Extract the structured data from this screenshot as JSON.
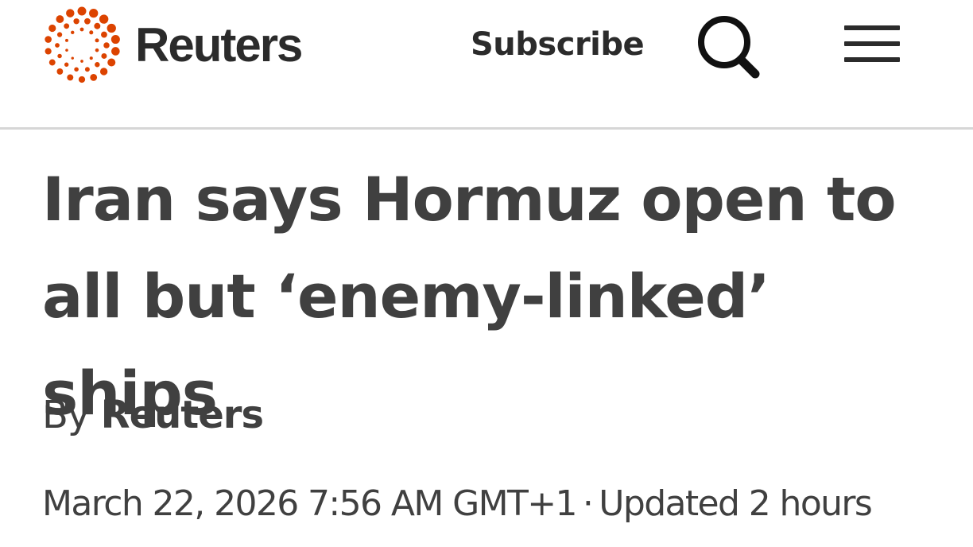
{
  "header": {
    "brand": "Reuters",
    "brand_color": "#dc4300",
    "subscribe_label": "Subscribe",
    "search_icon": "magnifier",
    "menu_icon": "hamburger"
  },
  "article": {
    "headline": "Iran says Hormuz open to all but ‘enemy-linked’ ships",
    "byline_prefix": "By",
    "byline_author": "Reuters",
    "published": "March 22, 2026 7:56 AM GMT+1",
    "separator": "·",
    "updated": "Updated 2 hours"
  }
}
